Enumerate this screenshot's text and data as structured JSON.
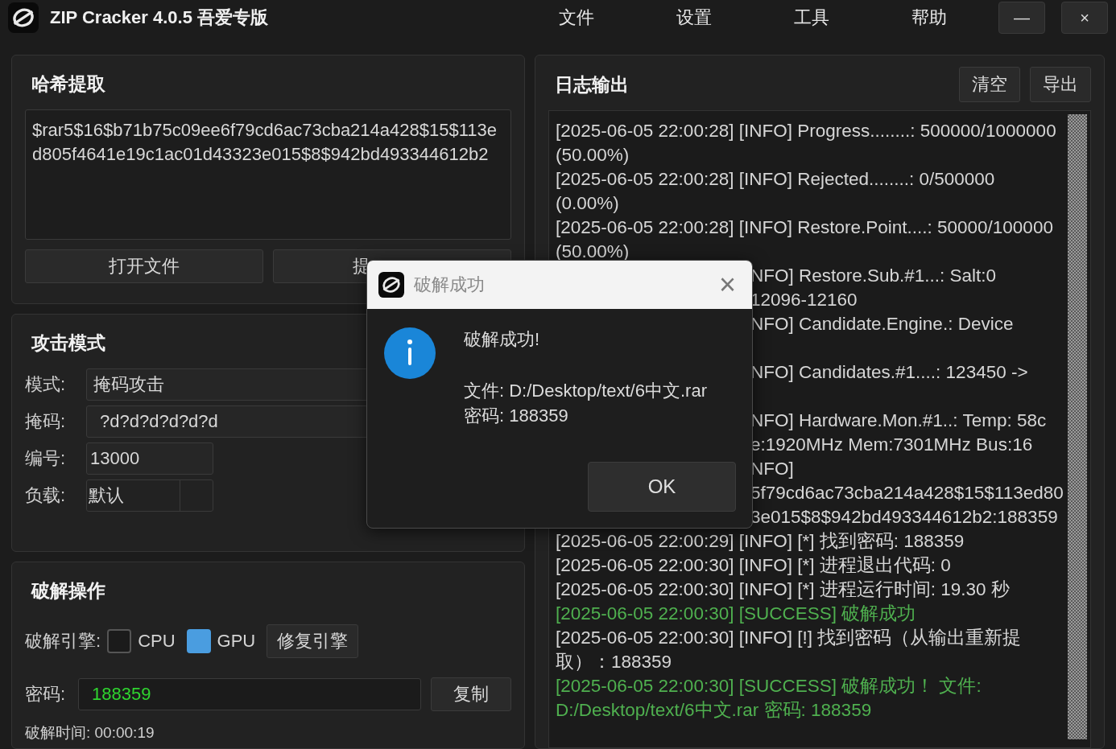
{
  "window": {
    "title": "ZIP Cracker 4.0.5 吾爱专版",
    "menu": [
      "文件",
      "设置",
      "工具",
      "帮助"
    ],
    "minimize": "—",
    "close": "×"
  },
  "hash_panel": {
    "title": "哈希提取",
    "hash": "$rar5$16$b71b75c09ee6f79cd6ac73cba214a428$15$113ed805f4641e19c1ac01d43323e015$8$942bd493344612b2",
    "buttons": [
      "打开文件",
      "提"
    ]
  },
  "attack_panel": {
    "title": "攻击模式",
    "mode_label": "模式:",
    "mode": "掩码攻击",
    "mask_label": "掩码:",
    "mask": "?d?d?d?d?d?d",
    "number_label": "编号:",
    "number": "13000",
    "load_label": "负载:",
    "load": "默认"
  },
  "crack_panel": {
    "title": "破解操作",
    "engine_label": "破解引擎:",
    "engines": [
      {
        "label": "CPU",
        "checked": false
      },
      {
        "label": "GPU",
        "checked": true
      }
    ],
    "repair_button": "修复引擎",
    "password_label": "密码:",
    "password": "188359",
    "copy_button": "复制",
    "time": "破解时间: 00:00:19"
  },
  "log_panel": {
    "title": "日志输出",
    "buttons": [
      "清空",
      "导出"
    ],
    "entries": [
      {
        "kind": "info",
        "text": "[2025-06-05 22:00:28] [INFO] Progress........: 500000/1000000 (50.00%)"
      },
      {
        "kind": "info",
        "text": "[2025-06-05 22:00:28] [INFO] Rejected........: 0/500000 (0.00%)"
      },
      {
        "kind": "info",
        "text": "[2025-06-05 22:00:28] [INFO] Restore.Point....: 50000/100000 (50.00%)"
      },
      {
        "kind": "covered",
        "text": "NFO] Restore.Sub.#1...: Salt:0"
      },
      {
        "kind": "covered",
        "text": "12096-12160"
      },
      {
        "kind": "covered",
        "text": "NFO] Candidate.Engine.: Device",
        "hidden_line": true
      },
      {
        "kind": "covered",
        "text": "NFO] Candidates.#1....: 123450 ->",
        "hidden_line": true
      },
      {
        "kind": "covered",
        "text": "NFO] Hardware.Mon.#1..: Temp: 58c"
      },
      {
        "kind": "covered",
        "text": "e:1920MHz Mem:7301MHz Bus:16"
      },
      {
        "kind": "covered",
        "text": "NFO]"
      },
      {
        "kind": "covered",
        "text": "5f79cd6ac73cba214a428$15$113ed80"
      },
      {
        "kind": "covered",
        "text": "3e015$8$942bd493344612b2:188359"
      },
      {
        "kind": "info",
        "text": "[2025-06-05 22:00:29] [INFO] [*] 找到密码: 188359"
      },
      {
        "kind": "info",
        "text": "[2025-06-05 22:00:30] [INFO] [*] 进程退出代码: 0"
      },
      {
        "kind": "info",
        "text": "[2025-06-05 22:00:30] [INFO] [*] 进程运行时间: 19.30 秒"
      },
      {
        "kind": "success",
        "text": "[2025-06-05 22:00:30] [SUCCESS] 破解成功"
      },
      {
        "kind": "info",
        "text": "[2025-06-05 22:00:30] [INFO] [!] 找到密码（从输出重新提取）：188359"
      },
      {
        "kind": "success",
        "text": "[2025-06-05 22:00:30] [SUCCESS] 破解成功！  文件: D:/Desktop/text/6中文.rar 密码: 188359"
      }
    ]
  },
  "dialog": {
    "title": "破解成功",
    "close": "×",
    "message": "破解成功!",
    "file": "文件: D:/Desktop/text/6中文.rar",
    "password": "密码: 188359",
    "button": "OK"
  }
}
